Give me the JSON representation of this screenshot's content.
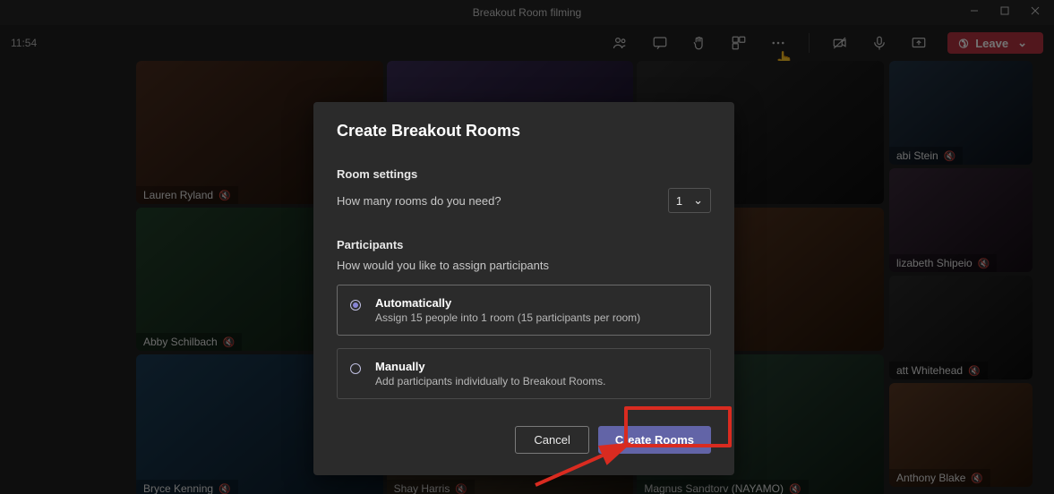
{
  "window": {
    "title": "Breakout Room filming"
  },
  "toolbar": {
    "time": "11:54",
    "leave_label": "Leave"
  },
  "participants": [
    {
      "name": "Lauren Ryland"
    },
    {
      "name": "Abby Schilbach"
    },
    {
      "name": "Bryce Kenning"
    },
    {
      "name": "Shay Harris"
    },
    {
      "name": "Magnus Sandtorv (NAYAMO)"
    },
    {
      "name": "abi Stein"
    },
    {
      "name": "lizabeth Shipeio"
    },
    {
      "name": "att Whitehead"
    },
    {
      "name": "Anthony Blake"
    }
  ],
  "dialog": {
    "title": "Create Breakout Rooms",
    "room_settings_label": "Room settings",
    "room_question": "How many rooms do you need?",
    "room_count": "1",
    "participants_label": "Participants",
    "assign_question": "How would you like to assign participants",
    "options": {
      "auto": {
        "title": "Automatically",
        "subtitle": "Assign 15 people into 1 room (15 participants per room)"
      },
      "manual": {
        "title": "Manually",
        "subtitle": "Add participants individually to Breakout Rooms."
      }
    },
    "cancel_label": "Cancel",
    "create_label": "Create Rooms"
  },
  "colors": {
    "accent": "#6264a7",
    "danger": "#b53341",
    "highlight": "#d92b20"
  }
}
